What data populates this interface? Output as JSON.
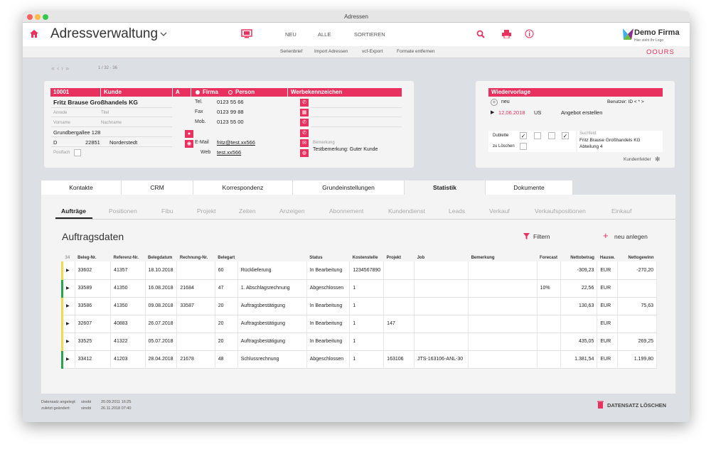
{
  "window": {
    "title": "Adressen"
  },
  "toolbar": {
    "app_title": "Adressverwaltung",
    "nav": [
      "NEU",
      "ALLE",
      "SORTIEREN"
    ],
    "brand": "Demo Firma",
    "brand_sub": "Hier steht Ihr Logo"
  },
  "subbar": {
    "items": [
      "Serienbrief",
      "Import Adressen",
      "vcf-Export",
      "Formate entfernen"
    ],
    "brand_right": "OOURS"
  },
  "record_nav": {
    "pos": "1 / 32 - 36"
  },
  "contact": {
    "id": "10001",
    "type": "Kunde",
    "abc": "A",
    "radio_firma": "Firma",
    "radio_person": "Person",
    "werbe": "Werbekennzeichen",
    "company": "Fritz Brause Großhandels KG",
    "anrede": "Anrede",
    "titel": "Titel",
    "vorname": "Vorname",
    "nachname": "Nachname",
    "street": "Grundbergallee 128",
    "country": "D",
    "zip": "22851",
    "city": "Norderstedt",
    "postfach": "Postfach",
    "tel_label": "Tel.",
    "tel": "0123 55 66",
    "fax_label": "Fax",
    "fax": "0123 99 88",
    "mob_label": "Mob.",
    "mob": "0123 55 00",
    "email_label": "E-Mail",
    "email": "fritz@test.xx566",
    "web_label": "Web",
    "web": "test.xx566",
    "bemerkung_label": "Bemerkung",
    "bemerkung": "Testbemerkung: Guter Kunde"
  },
  "wiedervorlage": {
    "title": "Wiedervorlage",
    "neu": "neu",
    "benutzer": "Benutzer: ID < * >",
    "date": "12.06.2018",
    "user": "US",
    "text": "Angebot erstellen"
  },
  "dublette": {
    "label": "Dublette",
    "zu_loeschen": "zu Löschen",
    "suchfeld_label": "Suchfeld",
    "suchfeld_line1": "Fritz Brause Großhandels KG",
    "suchfeld_line2": "Abteilung 4",
    "kundenfelder": "Kundenfelder"
  },
  "tabs": [
    "Kontakte",
    "CRM",
    "Korrespondenz",
    "Grundeinstellungen",
    "Statistik",
    "Dokumente"
  ],
  "subtabs": [
    "Aufträge",
    "Positionen",
    "Fibu",
    "Projekt",
    "Zeiten",
    "Anzeigen",
    "Abonnement",
    "Kundendienst",
    "Leads",
    "Verkauf",
    "Verkaufspositionen",
    "Einkauf"
  ],
  "section": {
    "title": "Auftragsdaten",
    "filter": "Filtern",
    "new": "neu anlegen"
  },
  "table": {
    "count": "34",
    "headers": [
      "Beleg-Nr.",
      "Referenz-Nr.",
      "Belegdatum",
      "Rechnung-Nr.",
      "Belegart",
      "",
      "Status",
      "Kostenstelle",
      "Projekt",
      "Job",
      "Bemerkung",
      "Forecast",
      "Nettobetrag",
      "Hausw.",
      "Nettogewinn"
    ],
    "rows": [
      {
        "beleg": "33602",
        "ref": "41357",
        "datum": "18.10.2018",
        "rechnung": "",
        "art_nr": "60",
        "art": "Rücklieferung",
        "status": "In Bearbeitung",
        "kst": "1234567890",
        "projekt": "",
        "job": "",
        "bem": "",
        "forecast": "",
        "netto": "-309,23",
        "hw": "EUR",
        "gewinn": "-270,20",
        "marker": "#f2d94e"
      },
      {
        "beleg": "33589",
        "ref": "41350",
        "datum": "16.08.2018",
        "rechnung": "21684",
        "art_nr": "47",
        "art": "1. Abschlagsrechnung",
        "status": "Abgeschlossen",
        "kst": "1",
        "projekt": "",
        "job": "",
        "bem": "",
        "forecast": "10%",
        "netto": "22,56",
        "hw": "EUR",
        "gewinn": "",
        "marker": "#2aa64a"
      },
      {
        "beleg": "33586",
        "ref": "41350",
        "datum": "09.08.2018",
        "rechnung": "33587",
        "art_nr": "20",
        "art": "Auftragsbestätigung",
        "status": "In Bearbeitung",
        "kst": "1",
        "projekt": "",
        "job": "",
        "bem": "",
        "forecast": "",
        "netto": "130,63",
        "hw": "EUR",
        "gewinn": "75,63",
        "marker": "#f2d94e"
      },
      {
        "beleg": "32607",
        "ref": "40883",
        "datum": "26.07.2018",
        "rechnung": "",
        "art_nr": "20",
        "art": "Auftragsbestätigung",
        "status": "In Bearbeitung",
        "kst": "1",
        "projekt": "147",
        "job": "",
        "bem": "",
        "forecast": "",
        "netto": "",
        "hw": "EUR",
        "gewinn": "",
        "marker": "#f2d94e"
      },
      {
        "beleg": "33525",
        "ref": "41322",
        "datum": "05.07.2018",
        "rechnung": "",
        "art_nr": "20",
        "art": "Auftragsbestätigung",
        "status": "In Bearbeitung",
        "kst": "1",
        "projekt": "",
        "job": "",
        "bem": "",
        "forecast": "",
        "netto": "435,05",
        "hw": "EUR",
        "gewinn": "269,25",
        "marker": "#f2d94e"
      },
      {
        "beleg": "33412",
        "ref": "41203",
        "datum": "28.04.2018",
        "rechnung": "21678",
        "art_nr": "48",
        "art": "Schlussrechnung",
        "status": "Abgeschlossen",
        "kst": "1",
        "projekt": "163106",
        "job": "JTS-163106-ANL-30",
        "bem": "",
        "forecast": "",
        "netto": "1.381,54",
        "hw": "EUR",
        "gewinn": "1.199,80",
        "marker": "#2aa64a"
      }
    ]
  },
  "footer": {
    "angelegt_label": "Datensatz angelegt:",
    "angelegt_user": "sinobi",
    "angelegt_date": "20.09.2011 16:25",
    "geaendert_label": "zuletzt geändert:",
    "geaendert_user": "sinobi",
    "geaendert_date": "26.11.2018 07:40",
    "delete": "DATENSATZ LÖSCHEN"
  },
  "colors": {
    "accent": "#e8315e",
    "yellow": "#f2d94e",
    "green": "#2aa64a"
  }
}
